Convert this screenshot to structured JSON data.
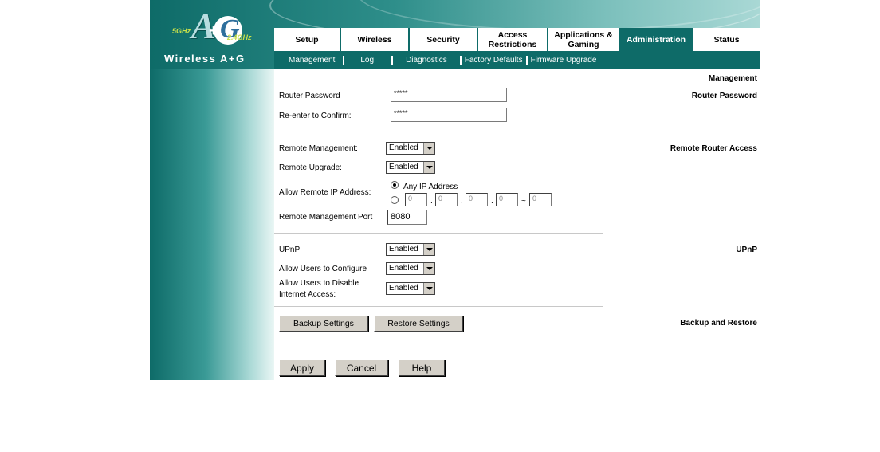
{
  "brand": {
    "logo_text": "Wireless A+G",
    "badge_5ghz": "5GHz",
    "badge_24ghz": "2.4GHz",
    "letter_a": "A",
    "letter_g": "G",
    "plus": "+"
  },
  "tabs": [
    {
      "label": "Setup"
    },
    {
      "label": "Wireless"
    },
    {
      "label": "Security"
    },
    {
      "label": "Access Restrictions"
    },
    {
      "label": "Applications & Gaming"
    },
    {
      "label": "Administration"
    },
    {
      "label": "Status"
    }
  ],
  "subnav": [
    "Management",
    "Log",
    "Diagnostics",
    "Factory Defaults",
    "Firmware Upgrade"
  ],
  "page_heading": "Management",
  "router_password": {
    "section": "Router Password",
    "password_label": "Router Password",
    "password_value": "*****",
    "confirm_label": "Re-enter to Confirm:",
    "confirm_value": "*****"
  },
  "remote_access": {
    "section": "Remote Router Access",
    "mgmt_label": "Remote Management:",
    "mgmt_value": "Enabled",
    "upgrade_label": "Remote Upgrade:",
    "upgrade_value": "Enabled",
    "allow_ip_label": "Allow Remote IP Address:",
    "any_ip_label": "Any IP Address",
    "ip": [
      "0",
      "0",
      "0",
      "0",
      "0"
    ],
    "ip_dot": ".",
    "ip_range": "~",
    "port_label": "Remote Management Port",
    "port_value": "8080"
  },
  "upnp": {
    "section": "UPnP",
    "upnp_label": "UPnP:",
    "upnp_value": "Enabled",
    "configure_label": "Allow Users to Configure",
    "configure_value": "Enabled",
    "disable_label_1": "Allow Users to Disable",
    "disable_label_2": "Internet Access:",
    "disable_value": "Enabled"
  },
  "backup": {
    "section": "Backup and Restore",
    "backup_button": "Backup Settings",
    "restore_button": "Restore Settings"
  },
  "actions": {
    "apply": "Apply",
    "cancel": "Cancel",
    "help": "Help"
  },
  "colors": {
    "teal": "#0e6b68",
    "button_face": "#d4d0c8"
  }
}
